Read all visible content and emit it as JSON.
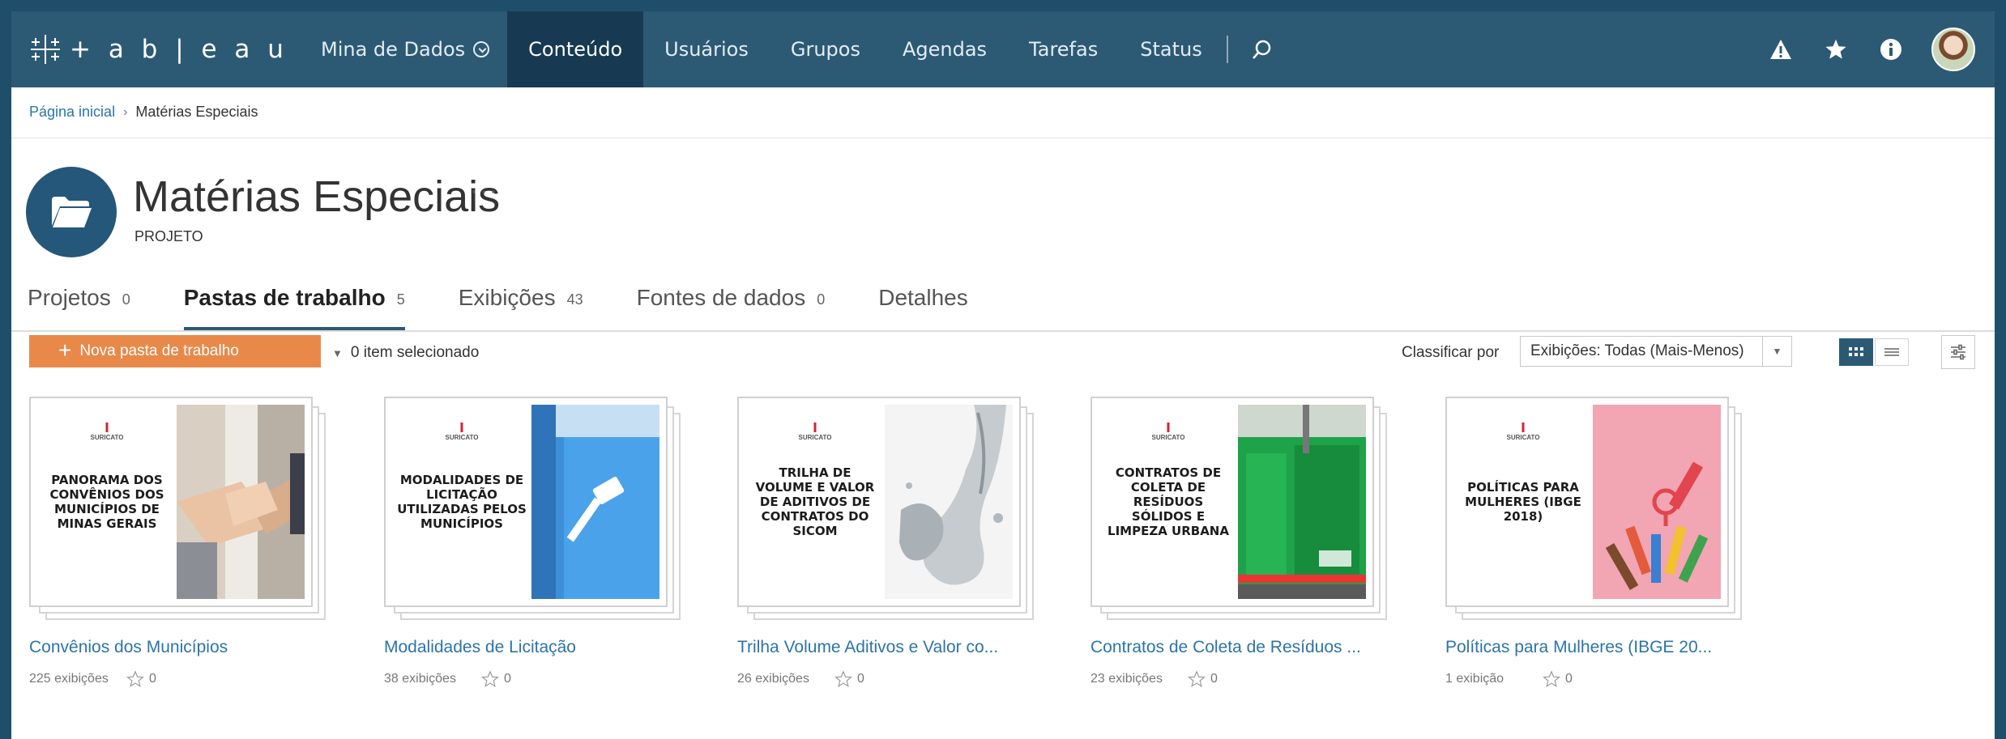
{
  "nav": {
    "logo_text": "+ a b | e a u",
    "site_name": "Mina de Dados",
    "items": [
      "Conteúdo",
      "Usuários",
      "Grupos",
      "Agendas",
      "Tarefas",
      "Status"
    ],
    "active_item": "Conteúdo",
    "right_icons": [
      "alert-icon",
      "star-icon",
      "info-icon"
    ]
  },
  "breadcrumb": {
    "home": "Página inicial",
    "separator": "›",
    "current": "Matérias Especiais"
  },
  "header": {
    "title": "Matérias Especiais",
    "more": "···",
    "subtitle": "PROJETO"
  },
  "tabs": [
    {
      "label": "Projetos",
      "count": "0"
    },
    {
      "label": "Pastas de trabalho",
      "count": "5",
      "active": true
    },
    {
      "label": "Exibições",
      "count": "43"
    },
    {
      "label": "Fontes de dados",
      "count": "0"
    },
    {
      "label": "Detalhes",
      "count": ""
    }
  ],
  "toolbar": {
    "new_button": "Nova pasta de trabalho",
    "selected": "0 item selecionado",
    "sort_label": "Classificar por",
    "sort_value": "Exibições: Todas (Mais-Menos)"
  },
  "brand_mark": "SURICATO",
  "workbooks": [
    {
      "thumb_title": "PANORAMA DOS CONVÊNIOS DOS MUNICÍPIOS DE MINAS GERAIS",
      "title": "Convênios dos Municípios",
      "views": "225 exibições",
      "favorites": "0",
      "image": "handshake"
    },
    {
      "thumb_title": "MODALIDADES DE LICITAÇÃO UTILIZADAS PELOS MUNICÍPIOS",
      "title": "Modalidades de Licitação",
      "views": "38 exibições",
      "favorites": "0",
      "image": "gavel"
    },
    {
      "thumb_title": "TRILHA DE VOLUME E VALOR DE ADITIVOS DE CONTRATOS DO SICOM",
      "title": "Trilha Volume Aditivos e Valor co...",
      "views": "26 exibições",
      "favorites": "0",
      "image": "water"
    },
    {
      "thumb_title": "CONTRATOS DE COLETA DE RESÍDUOS SÓLIDOS E LIMPEZA URBANA",
      "title": "Contratos de Coleta de Resíduos ...",
      "views": "23 exibições",
      "favorites": "0",
      "image": "garbage-truck"
    },
    {
      "thumb_title": "POLÍTICAS PARA MULHERES (IBGE 2018)",
      "title": "Políticas para Mulheres (IBGE 20...",
      "views": "1 exibição",
      "favorites": "0",
      "image": "raised-hands"
    }
  ],
  "colors": {
    "nav_bg": "#2c5a75",
    "nav_active": "#173a52",
    "accent_orange": "#e8894a",
    "link_blue": "#2c74a8",
    "brand_red": "#d3262e"
  }
}
